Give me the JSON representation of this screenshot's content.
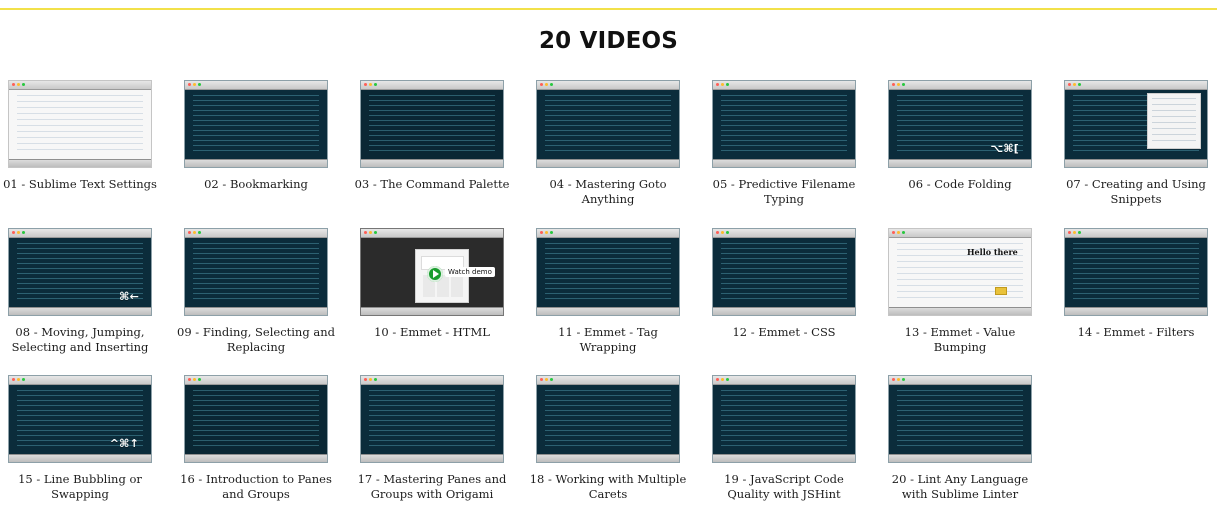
{
  "header": {
    "title": "20 VIDEOS"
  },
  "videos": [
    {
      "title": "01 - Sublime Text Settings",
      "thumb_overlay": ""
    },
    {
      "title": "02 - Bookmarking",
      "thumb_overlay": ""
    },
    {
      "title": "03 - The Command Palette",
      "thumb_overlay": ""
    },
    {
      "title": "04 - Mastering Goto Anything",
      "thumb_overlay": ""
    },
    {
      "title": "05 - Predictive Filename Typing",
      "thumb_overlay": ""
    },
    {
      "title": "06 - Code Folding",
      "thumb_overlay": "⌥⌘["
    },
    {
      "title": "07 - Creating and Using Snippets",
      "thumb_overlay": ""
    },
    {
      "title": "08 - Moving, Jumping, Selecting and Inserting",
      "thumb_overlay": "⌘←"
    },
    {
      "title": "09 - Finding, Selecting and Replacing",
      "thumb_overlay": ""
    },
    {
      "title": "10 - Emmet - HTML",
      "thumb_overlay": "",
      "thumb_cta": "Watch demo"
    },
    {
      "title": "11 - Emmet - Tag Wrapping",
      "thumb_overlay": ""
    },
    {
      "title": "12 - Emmet - CSS",
      "thumb_overlay": ""
    },
    {
      "title": "13 - Emmet - Value Bumping",
      "thumb_overlay": "",
      "thumb_heading": "Hello there"
    },
    {
      "title": "14 - Emmet - Filters",
      "thumb_overlay": ""
    },
    {
      "title": "15 - Line Bubbling or Swapping",
      "thumb_overlay": "^⌘↑"
    },
    {
      "title": "16 - Introduction to Panes and Groups",
      "thumb_overlay": ""
    },
    {
      "title": "17 - Mastering Panes and Groups with Origami",
      "thumb_overlay": ""
    },
    {
      "title": "18 - Working with Multiple Carets",
      "thumb_overlay": ""
    },
    {
      "title": "19 - JavaScript Code Quality with JSHint",
      "thumb_overlay": ""
    },
    {
      "title": "20 - Lint Any Language with Sublime Linter",
      "thumb_overlay": ""
    }
  ],
  "colors": {
    "accent_line": "#f2e14a",
    "thumb_bg": "#0b2c3b",
    "title_text": "#111111",
    "caption_text": "#1d1d1d"
  }
}
